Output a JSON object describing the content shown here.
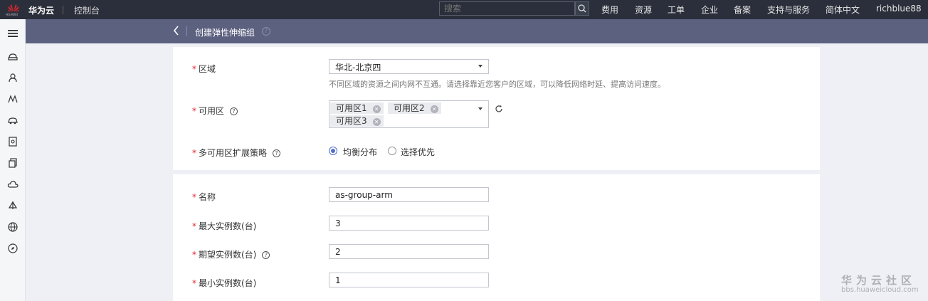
{
  "topbar": {
    "brand": "华为云",
    "logo_text": "HUAWEI",
    "console": "控制台",
    "search_placeholder": "搜索",
    "nav": [
      "费用",
      "资源",
      "工单",
      "企业",
      "备案",
      "支持与服务",
      "简体中文",
      "richblue88"
    ]
  },
  "header": {
    "title": "创建弹性伸缩组"
  },
  "sidebar": {
    "icons": [
      "menu-icon",
      "cloud-host-icon",
      "users-icon",
      "network-icon",
      "car-icon",
      "document-icon",
      "copy-icon",
      "cloud-icon",
      "sail-icon",
      "globe-icon",
      "compass-icon"
    ]
  },
  "form1": {
    "region_label": "区域",
    "region_value": "华北-北京四",
    "region_hint": "不同区域的资源之间内网不互通。请选择靠近您客户的区域，可以降低网络时延、提高访问速度。",
    "az_label": "可用区",
    "az_tags": [
      "可用区1",
      "可用区2",
      "可用区3"
    ],
    "strategy_label": "多可用区扩展策略",
    "strategy_options": [
      "均衡分布",
      "选择优先"
    ],
    "strategy_selected": "均衡分布"
  },
  "form2": {
    "name_label": "名称",
    "name_value": "as-group-arm",
    "max_label": "最大实例数(台)",
    "max_value": "3",
    "desired_label": "期望实例数(台)",
    "desired_value": "2",
    "min_label": "最小实例数(台)",
    "min_value": "1"
  },
  "watermark": {
    "line1": "华为云社区",
    "line2": "bbs.huaweicloud.com"
  },
  "colors": {
    "topbar": "#2b2f3b",
    "subbar": "#5d6180",
    "required": "#e0252c",
    "accent": "#526ecc"
  }
}
